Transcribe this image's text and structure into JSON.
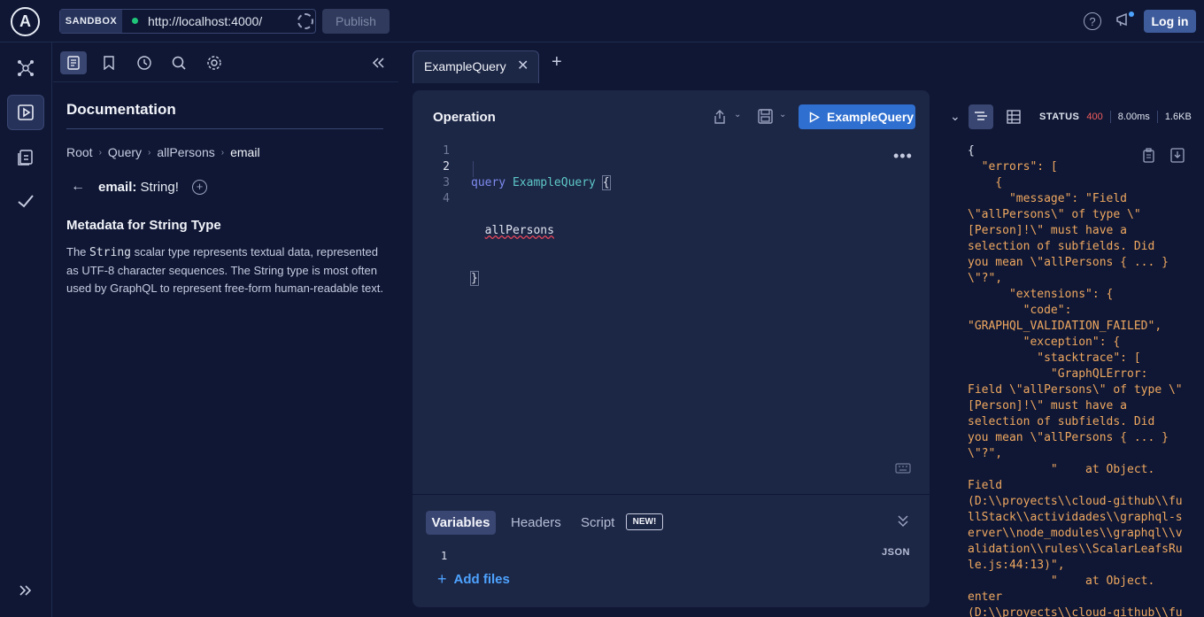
{
  "topbar": {
    "sandbox_label": "SANDBOX",
    "url": "http://localhost:4000/",
    "publish_label": "Publish",
    "login_label": "Log in"
  },
  "docs": {
    "title": "Documentation",
    "breadcrumb": [
      "Root",
      "Query",
      "allPersons",
      "email"
    ],
    "field_name": "email:",
    "field_type": "String!",
    "metadata_heading": "Metadata for String Type",
    "desc_pre": "The ",
    "desc_code": "String",
    "desc_post": " scalar type represents textual data, represented as UTF-8 character sequences. The String type is most often used by GraphQL to represent free-form human-readable text."
  },
  "tab": {
    "label": "ExampleQuery"
  },
  "operation": {
    "title": "Operation",
    "run_label": "ExampleQuery",
    "lines": [
      "1",
      "2",
      "3",
      "4"
    ],
    "code": {
      "kw": "query",
      "name": "ExampleQuery",
      "brace_open": "{",
      "field": "allPersons",
      "brace_close": "}"
    }
  },
  "variables": {
    "tabs": [
      "Variables",
      "Headers",
      "Script"
    ],
    "new_badge": "NEW!",
    "line": "1",
    "json_label": "JSON",
    "add_files": "Add files"
  },
  "response": {
    "status_label": "STATUS",
    "status_code": "400",
    "time": "8.00ms",
    "size": "1.6KB",
    "lines": [
      "{",
      "  \"errors\": [",
      "    {",
      "      \"message\": \"Field",
      "\\\"allPersons\\\" of type \\\"",
      "[Person]!\\\" must have a",
      "selection of subfields. Did",
      "you mean \\\"allPersons { ... }",
      "\\\"?\",",
      "      \"extensions\": {",
      "        \"code\":",
      "\"GRAPHQL_VALIDATION_FAILED\",",
      "        \"exception\": {",
      "          \"stacktrace\": [",
      "            \"GraphQLError:",
      "Field \\\"allPersons\\\" of type \\\"",
      "[Person]!\\\" must have a",
      "selection of subfields. Did",
      "you mean \\\"allPersons { ... }",
      "\\\"?\",",
      "            \"    at Object.",
      "Field",
      "(D:\\\\proyects\\\\cloud-github\\\\fu",
      "llStack\\\\actividades\\\\graphql-s",
      "erver\\\\node_modules\\\\graphql\\\\v",
      "alidation\\\\rules\\\\ScalarLeafsRu",
      "le.js:44:13)\",",
      "            \"    at Object.",
      "enter",
      "(D:\\\\proyects\\\\cloud-github\\\\fu"
    ]
  },
  "colors": {
    "accent": "#2f6fd0",
    "status": "#f25c5c",
    "json_text": "#f0a860",
    "keyword": "#7f8cf0",
    "name": "#5ec8c8"
  }
}
